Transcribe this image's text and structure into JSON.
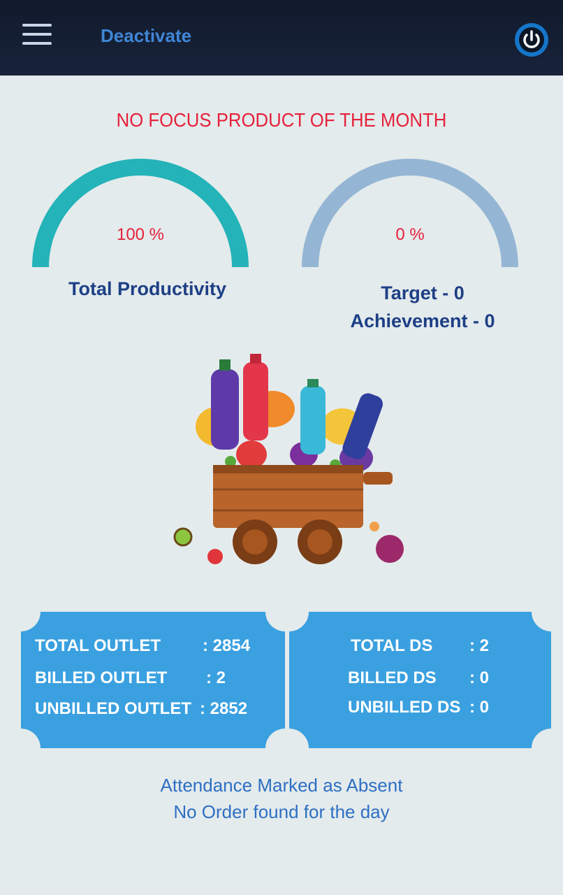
{
  "header": {
    "title": "Deactivate",
    "menu_icon": "hamburger-menu-icon",
    "power_icon": "power-icon"
  },
  "headline": "NO FOCUS PRODUCT OF THE MONTH",
  "gauges": [
    {
      "percent_text": "100 %",
      "value": 100,
      "label": "Total Productivity",
      "color": "#23b3b8"
    },
    {
      "percent_text": "0 %",
      "value": 0,
      "target_label": "Target - 0",
      "achievement_label": "Achievement - 0",
      "color": "#94b6d4"
    }
  ],
  "illustration": "fruit-basket-cart",
  "outlet_card": {
    "rows": [
      {
        "label": "TOTAL OUTLET",
        "value": ": 2854"
      },
      {
        "label": "BILLED OUTLET",
        "value": ": 2"
      },
      {
        "label": "UNBILLED OUTLET",
        "value": ": 2852"
      }
    ]
  },
  "ds_card": {
    "rows": [
      {
        "label": "TOTAL DS",
        "value": ": 2"
      },
      {
        "label": "BILLED DS",
        "value": ": 0"
      },
      {
        "label": "UNBILLED DS",
        "value": ": 0"
      }
    ]
  },
  "messages": {
    "attendance": "Attendance Marked as Absent",
    "orders": "No Order found for the day"
  },
  "colors": {
    "header_bg": "#141e32",
    "accent_red": "#e5213b",
    "card_blue": "#3aa0e0",
    "label_navy": "#1d3f86",
    "message_blue": "#2e6fc4"
  }
}
